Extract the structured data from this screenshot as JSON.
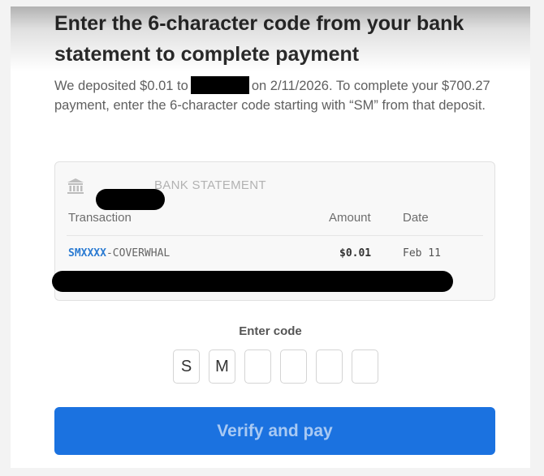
{
  "title": "Enter the 6-character code from your bank statement to complete payment",
  "description": {
    "before": "We deposited $0.01 to",
    "after": "on 2/11/2026. To complete your $700.27 payment, enter the 6-character code starting with “SM” from that deposit."
  },
  "statement": {
    "header_icon": "bank-icon",
    "header_label": "BANK STATEMENT",
    "columns": {
      "transaction": "Transaction",
      "amount": "Amount",
      "date": "Date"
    },
    "row": {
      "code": "SMXXXX",
      "merchant": "-COVERWHAL",
      "amount": "$0.01",
      "date": "Feb 11"
    }
  },
  "enter_code": {
    "label": "Enter code",
    "boxes": [
      "S",
      "M",
      "",
      "",
      "",
      ""
    ]
  },
  "verify_button": "Verify and pay",
  "colors": {
    "accent": "#1b72e0",
    "code_link": "#2b7bd2"
  }
}
